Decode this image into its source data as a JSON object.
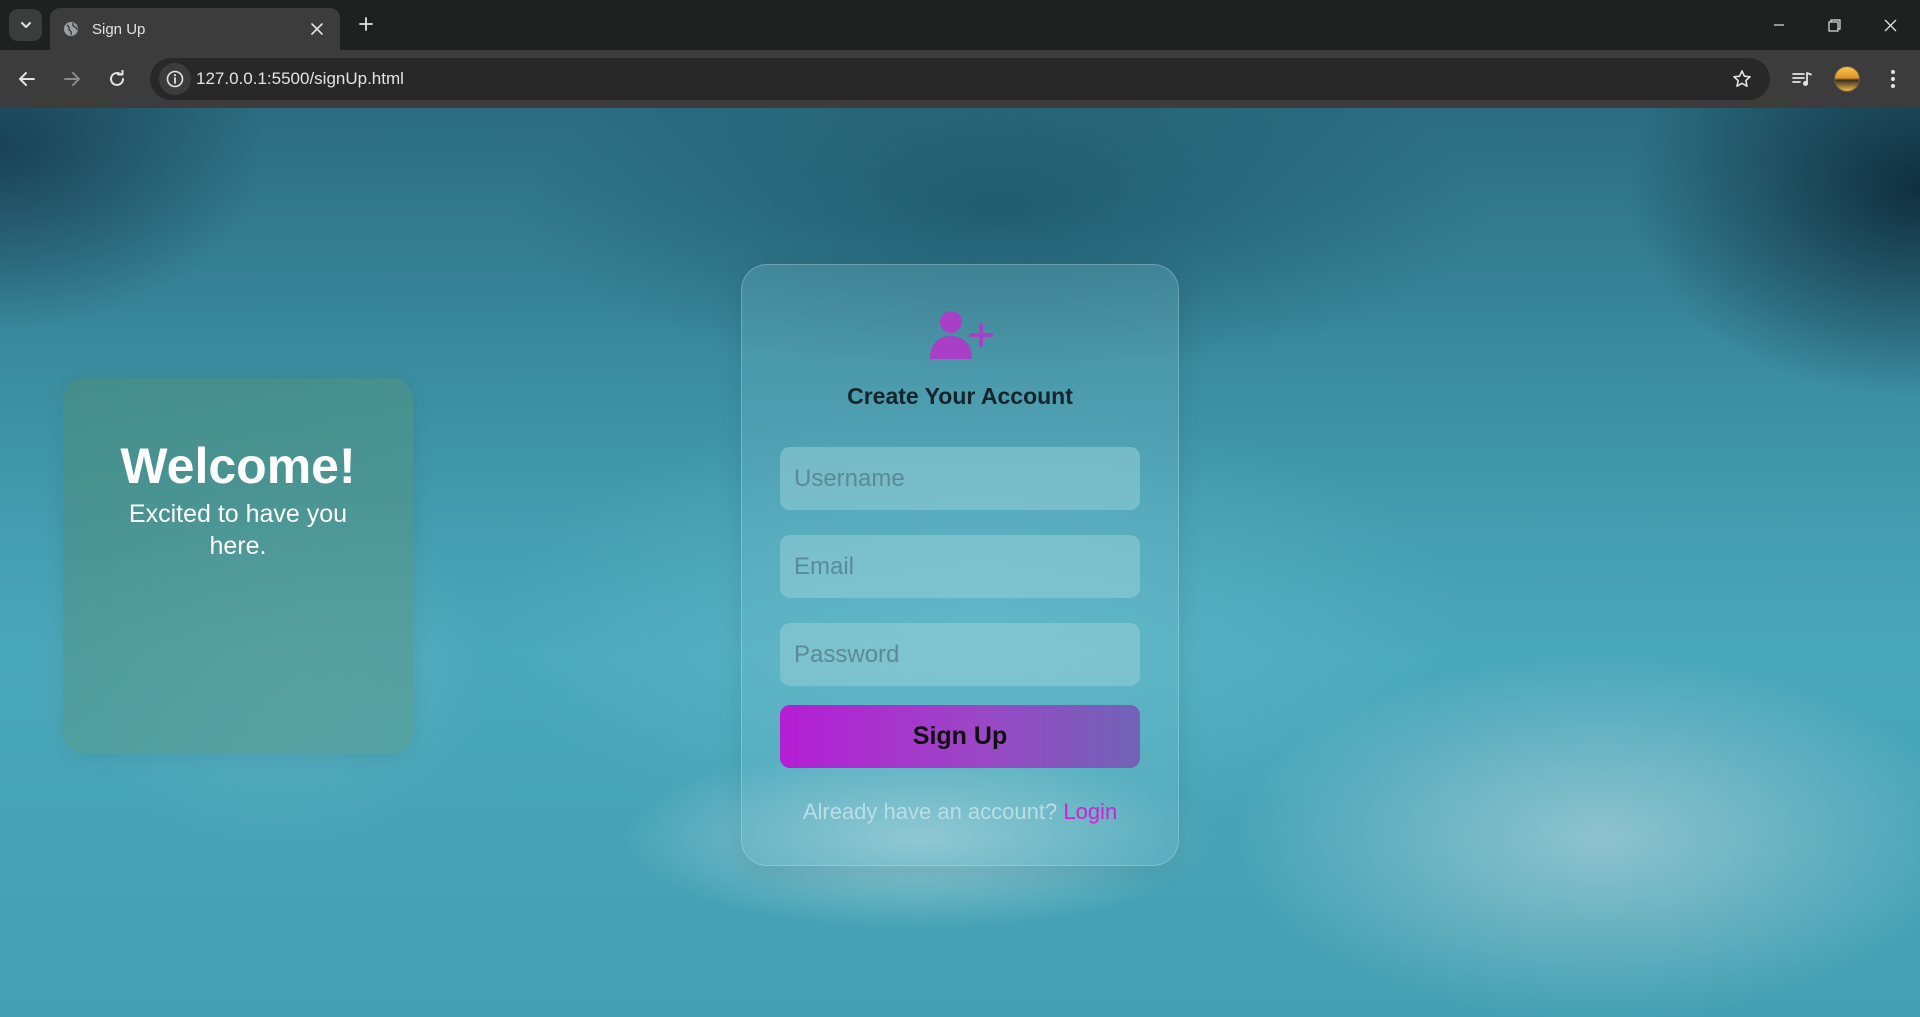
{
  "browser": {
    "tab": {
      "title": "Sign Up",
      "favicon": "globe-icon"
    },
    "url": "127.0.0.1:5500/signUp.html",
    "toolbar_icons": [
      "back-arrow-icon",
      "forward-arrow-icon",
      "reload-icon",
      "info-icon",
      "star-icon",
      "media-icon",
      "avatar",
      "kebab-menu-icon"
    ]
  },
  "welcome": {
    "title": "Welcome!",
    "subtitle": "Excited to have you here."
  },
  "signup": {
    "icon": "user-plus-icon",
    "title": "Create Your Account",
    "username_placeholder": "Username",
    "email_placeholder": "Email",
    "password_placeholder": "Password",
    "button_label": "Sign Up",
    "login_prompt": "Already have an account?",
    "login_link": "Login"
  },
  "colors": {
    "accent": "#b51dd5",
    "link": "#d21fd2",
    "browser_chrome": "#3c3c3c"
  }
}
